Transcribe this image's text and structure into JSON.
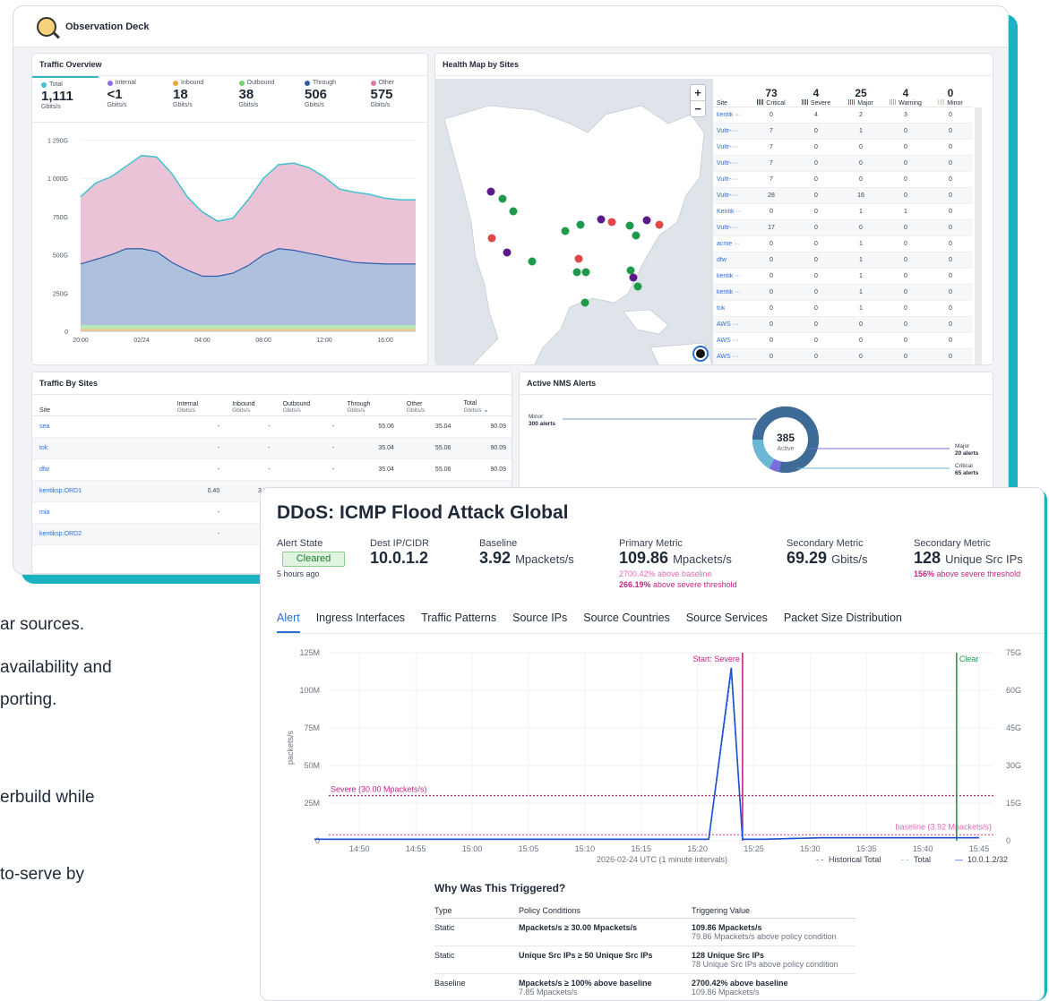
{
  "dashboard": {
    "title": "Observation Deck",
    "traffic_overview": {
      "title": "Traffic Overview",
      "tabs": [
        {
          "label": "Total",
          "value": "1,111",
          "unit": "Gbits/s",
          "color": "#3ec3cf"
        },
        {
          "label": "Internal",
          "value": "<1",
          "unit": "Gbits/s",
          "color": "#8b6ce0"
        },
        {
          "label": "Inbound",
          "value": "18",
          "unit": "Gbits/s",
          "color": "#f0a43a"
        },
        {
          "label": "Outbound",
          "value": "38",
          "unit": "Gbits/s",
          "color": "#6fd36f"
        },
        {
          "label": "Through",
          "value": "506",
          "unit": "Gbits/s",
          "color": "#2f5fa8"
        },
        {
          "label": "Other",
          "value": "575",
          "unit": "Gbits/s",
          "color": "#e07aa8"
        }
      ]
    },
    "health_map": {
      "title": "Health Map by Sites",
      "zoom_in": "+",
      "zoom_out": "−",
      "columns": [
        {
          "count": "73",
          "label": "Critical"
        },
        {
          "count": "4",
          "label": "Severe"
        },
        {
          "count": "25",
          "label": "Major"
        },
        {
          "count": "4",
          "label": "Warning"
        },
        {
          "count": "0",
          "label": "Minor"
        }
      ],
      "site_header": "Site",
      "rows": [
        {
          "site": "kentik ···",
          "v": [
            "0",
            "4",
            "2",
            "3",
            "0"
          ]
        },
        {
          "site": "Vultr-···",
          "v": [
            "7",
            "0",
            "1",
            "0",
            "0"
          ]
        },
        {
          "site": "Vultr-···",
          "v": [
            "7",
            "0",
            "0",
            "0",
            "0"
          ]
        },
        {
          "site": "Vultr-···",
          "v": [
            "7",
            "0",
            "0",
            "0",
            "0"
          ]
        },
        {
          "site": "Vultr-···",
          "v": [
            "7",
            "0",
            "0",
            "0",
            "0"
          ]
        },
        {
          "site": "Vultr-···",
          "v": [
            "28",
            "0",
            "16",
            "0",
            "0"
          ]
        },
        {
          "site": "Kentik ···",
          "v": [
            "0",
            "0",
            "1",
            "1",
            "0"
          ]
        },
        {
          "site": "Vultr-···",
          "v": [
            "17",
            "0",
            "0",
            "0",
            "0"
          ]
        },
        {
          "site": "acme ···",
          "v": [
            "0",
            "0",
            "1",
            "0",
            "0"
          ]
        },
        {
          "site": "dfw",
          "v": [
            "0",
            "0",
            "1",
            "0",
            "0"
          ]
        },
        {
          "site": "kentik ···",
          "v": [
            "0",
            "0",
            "1",
            "0",
            "0"
          ]
        },
        {
          "site": "kentik ···",
          "v": [
            "0",
            "0",
            "1",
            "0",
            "0"
          ]
        },
        {
          "site": "tok",
          "v": [
            "0",
            "0",
            "1",
            "0",
            "0"
          ]
        },
        {
          "site": "AWS ···",
          "v": [
            "0",
            "0",
            "0",
            "0",
            "0"
          ]
        },
        {
          "site": "AWS ···",
          "v": [
            "0",
            "0",
            "0",
            "0",
            "0"
          ]
        },
        {
          "site": "AWS ···",
          "v": [
            "0",
            "0",
            "0",
            "0",
            "0"
          ]
        }
      ]
    },
    "traffic_by_sites": {
      "title": "Traffic By Sites",
      "headers": [
        {
          "name": "Site",
          "unit": ""
        },
        {
          "name": "Internal",
          "unit": "Gbits/s"
        },
        {
          "name": "Inbound",
          "unit": "Gbits/s"
        },
        {
          "name": "Outbound",
          "unit": "Gbits/s"
        },
        {
          "name": "Through",
          "unit": "Gbits/s"
        },
        {
          "name": "Other",
          "unit": "Gbits/s"
        },
        {
          "name": "Total",
          "unit": "Gbits/s"
        }
      ],
      "rows": [
        [
          "sea",
          "-",
          "-",
          "-",
          "55.06",
          "35.04",
          "90.09"
        ],
        [
          "tok",
          "-",
          "-",
          "-",
          "35.04",
          "55.06",
          "90.09"
        ],
        [
          "dfw",
          "-",
          "-",
          "-",
          "35.04",
          "55.06",
          "90.09"
        ],
        [
          "kentiksp.ORD1",
          "0.40",
          "3.92",
          "",
          "",
          "",
          ""
        ],
        [
          "mia",
          "-",
          "",
          "",
          "",
          "",
          ""
        ],
        [
          "kentiksp.ORD2",
          "-",
          "-",
          "",
          "",
          "",
          ""
        ]
      ]
    },
    "nms_alerts": {
      "title": "Active NMS Alerts",
      "total": "385",
      "total_label": "Active",
      "minor": {
        "label": "Minor",
        "detail": "300 alerts",
        "count": 300
      },
      "major": {
        "label": "Major",
        "detail": "20 alerts",
        "count": 20
      },
      "critical": {
        "label": "Critical",
        "detail": "65 alerts",
        "count": 65
      }
    }
  },
  "background_text": [
    "ar sources.",
    " availability and",
    "porting.",
    "erbuild while",
    "to-serve by"
  ],
  "ddos": {
    "title": "DDoS: ICMP Flood Attack Global",
    "alert_state": {
      "label": "Alert State",
      "value": "Cleared",
      "ago": "5 hours ago"
    },
    "dest": {
      "label": "Dest IP/CIDR",
      "value": "10.0.1.2"
    },
    "baseline": {
      "label": "Baseline",
      "value": "3.92",
      "unit": "Mpackets/s"
    },
    "primary": {
      "label": "Primary Metric",
      "value": "109.86",
      "unit": "Mpackets/s",
      "note1": "2700.42% above baseline",
      "note2_pct": "266.19%",
      "note2_rest": " above severe threshold"
    },
    "secondary1": {
      "label": "Secondary Metric",
      "value": "69.29",
      "unit": "Gbits/s"
    },
    "secondary2": {
      "label": "Secondary Metric",
      "value": "128",
      "unit": "Unique Src IPs",
      "note_pct": "156%",
      "note_rest": " above severe threshold"
    },
    "tabs": [
      "Alert",
      "Ingress Interfaces",
      "Traffic Patterns",
      "Source IPs",
      "Source Countries",
      "Source Services",
      "Packet Size Distribution"
    ],
    "why": {
      "title": "Why Was This Triggered?",
      "headers": [
        "Type",
        "Policy Conditions",
        "Triggering Value"
      ],
      "rows": [
        {
          "type": "Static",
          "cond": "Mpackets/s ≥ 30.00 Mpackets/s",
          "cond_sub": "",
          "val": "109.86 Mpackets/s",
          "val_sub": "79.86 Mpackets/s above policy condition"
        },
        {
          "type": "Static",
          "cond": "Unique Src IPs ≥ 50 Unique Src IPs",
          "cond_sub": "",
          "val": "128 Unique Src IPs",
          "val_sub": "78 Unique Src IPs above policy condition"
        },
        {
          "type": "Baseline",
          "cond": "Mpackets/s ≥ 100% above baseline",
          "cond_sub": "7.85 Mpackets/s",
          "val": "2700.42% above baseline",
          "val_sub": "109.86 Mpackets/s"
        }
      ]
    }
  },
  "chart_data": [
    {
      "type": "area",
      "title": "Traffic Overview",
      "x": [
        "20:00",
        "21:00",
        "22:00",
        "23:00",
        "02/24",
        "01:00",
        "02:00",
        "03:00",
        "04:00",
        "05:00",
        "06:00",
        "07:00",
        "08:00",
        "09:00",
        "10:00",
        "11:00",
        "12:00",
        "13:00",
        "14:00",
        "15:00",
        "16:00",
        "17:00",
        "18:00"
      ],
      "xticks": [
        "20:00",
        "02/24",
        "04:00",
        "08:00",
        "12:00",
        "16:00"
      ],
      "yticks": [
        "0",
        "250G",
        "500G",
        "750G",
        "1 000G",
        "1 250G"
      ],
      "ylim": [
        0,
        1300
      ],
      "series": [
        {
          "name": "Through",
          "color": "#2f5fa8",
          "values": [
            440,
            470,
            500,
            540,
            540,
            520,
            450,
            400,
            360,
            360,
            380,
            430,
            500,
            540,
            530,
            510,
            490,
            470,
            450,
            445,
            440,
            440,
            440
          ]
        },
        {
          "name": "Other",
          "color": "#e07aa8",
          "values": [
            440,
            500,
            510,
            540,
            560,
            570,
            580,
            480,
            420,
            360,
            360,
            430,
            500,
            550,
            570,
            560,
            520,
            460,
            460,
            450,
            430,
            420,
            420
          ]
        },
        {
          "name": "Total",
          "color": "#3ec3cf",
          "values": [
            880,
            970,
            1010,
            1080,
            1150,
            1140,
            1030,
            880,
            780,
            720,
            740,
            860,
            1000,
            1090,
            1100,
            1070,
            1010,
            930,
            910,
            895,
            870,
            860,
            860
          ]
        }
      ]
    },
    {
      "type": "line",
      "title": "DDoS: ICMP Flood Attack Global",
      "xlabel": "2026-02-24 UTC (1 minute intervals)",
      "ylabel": "packets/s",
      "xticks": [
        "14:50",
        "14:55",
        "15:00",
        "15:05",
        "15:10",
        "15:15",
        "15:20",
        "15:25",
        "15:30",
        "15:35",
        "15:40",
        "15:45"
      ],
      "yticks_left": [
        "0",
        "25M",
        "50M",
        "75M",
        "100M",
        "125M"
      ],
      "yticks_right": [
        "0",
        "15G",
        "30G",
        "45G",
        "60G",
        "75G"
      ],
      "ylim": [
        0,
        125
      ],
      "series": [
        {
          "name": "10.0.1.2/32",
          "color": "#1f4fd0",
          "x_minutes": [
            0,
            10,
            20,
            30,
            35,
            37,
            38,
            40,
            45,
            50,
            55,
            59
          ],
          "values": [
            1,
            1,
            1,
            1,
            1,
            115,
            1,
            1,
            2,
            2,
            2,
            2
          ]
        },
        {
          "name": "Total",
          "color": "#5fb3e0",
          "x_minutes": [
            0,
            10,
            20,
            30,
            35,
            37,
            38,
            40,
            45,
            50,
            55,
            59
          ],
          "values": [
            1,
            1,
            1,
            1,
            1,
            112,
            1,
            1,
            2,
            2,
            2,
            2
          ]
        }
      ],
      "thresholds": [
        {
          "label": "Severe (30.00 Mpackets/s)",
          "value": 30,
          "color": "#c02684"
        },
        {
          "label": "baseline (3.92 Mpackets/s)",
          "value": 3.92,
          "color": "#e26bb4"
        }
      ],
      "markers": [
        {
          "label": "Start: Severe",
          "minute": 38,
          "color": "#c02684"
        },
        {
          "label": "Clear",
          "minute": 57,
          "color": "#1f9a4b"
        }
      ],
      "legend": [
        "Historical Total",
        "Total",
        "10.0.1.2/32"
      ]
    }
  ]
}
